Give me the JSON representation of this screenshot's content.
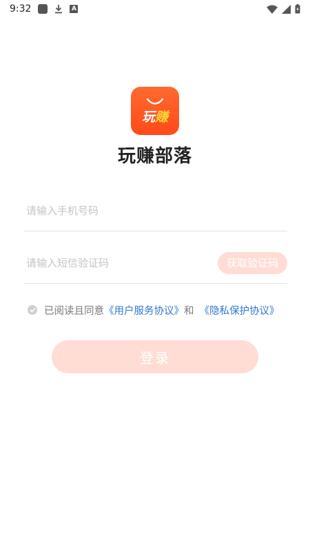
{
  "status_bar": {
    "time": "9:32",
    "icons": [
      "square-notification-icon",
      "download-icon",
      "a-notification-icon",
      "wifi-icon",
      "signal-icon",
      "battery-icon"
    ],
    "a_glyph": "A"
  },
  "app": {
    "logo_text_white": "玩",
    "logo_text_yellow": "赚",
    "name": "玩赚部落",
    "colors": {
      "brand": "#ff5a24",
      "brand_accent": "#ffd23a",
      "button_disabled": "#ffddd4",
      "link": "#2f78d6"
    }
  },
  "form": {
    "phone_placeholder": "请输入手机号码",
    "phone_value": "",
    "code_placeholder": "请输入短信验证码",
    "code_value": "",
    "get_code_label": "获取验证码"
  },
  "agreement": {
    "checked": true,
    "prefix": "已阅读且同意",
    "user_agreement": "《用户服务协议》",
    "and": "和",
    "privacy_policy": "《隐私保护协议》"
  },
  "login_label": "登录"
}
